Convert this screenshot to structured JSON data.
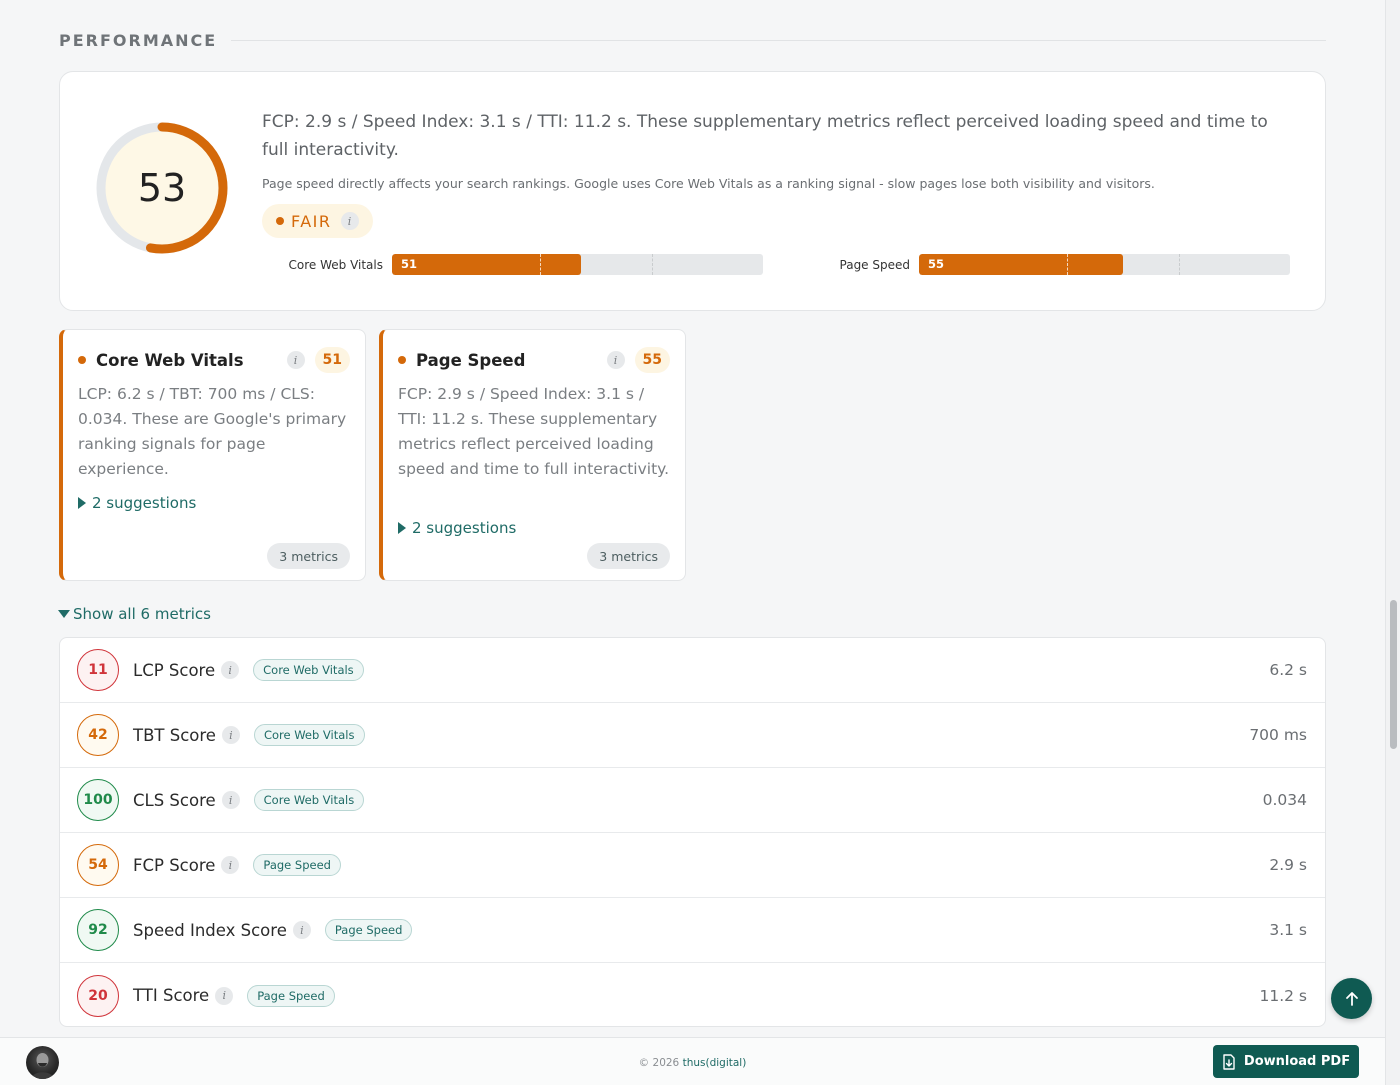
{
  "section": {
    "title": "PERFORMANCE"
  },
  "summary": {
    "score": "53",
    "score_fraction": 0.53,
    "text": "FCP: 2.9 s / Speed Index: 3.1 s / TTI: 11.2 s. These supplementary metrics reflect perceived loading speed and time to full interactivity.",
    "note": "Page speed directly affects your search rankings. Google uses Core Web Vitals as a ranking signal - slow pages lose both visibility and visitors.",
    "rating": "FAIR",
    "bars": [
      {
        "label": "Core Web Vitals",
        "value": "51",
        "fraction": 0.51
      },
      {
        "label": "Page Speed",
        "value": "55",
        "fraction": 0.55
      }
    ]
  },
  "categories": [
    {
      "name": "Core Web Vitals",
      "score": "51",
      "description": "LCP: 6.2 s / TBT: 700 ms / CLS: 0.034. These are Google's primary ranking signals for page experience.",
      "suggestions": "2 suggestions",
      "metrics": "3 metrics"
    },
    {
      "name": "Page Speed",
      "score": "55",
      "description": "FCP: 2.9 s / Speed Index: 3.1 s / TTI: 11.2 s. These supplementary metrics reflect perceived loading speed and time to full interactivity.",
      "suggestions": "2 suggestions",
      "metrics": "3 metrics"
    }
  ],
  "show_all_label": "Show all 6 metrics",
  "metrics": [
    {
      "score": "11",
      "name": "LCP Score",
      "tag": "Core Web Vitals",
      "value": "6.2 s",
      "status": "poor"
    },
    {
      "score": "42",
      "name": "TBT Score",
      "tag": "Core Web Vitals",
      "value": "700 ms",
      "status": "fair"
    },
    {
      "score": "100",
      "name": "CLS Score",
      "tag": "Core Web Vitals",
      "value": "0.034",
      "status": "good"
    },
    {
      "score": "54",
      "name": "FCP Score",
      "tag": "Page Speed",
      "value": "2.9 s",
      "status": "fair"
    },
    {
      "score": "92",
      "name": "Speed Index Score",
      "tag": "Page Speed",
      "value": "3.1 s",
      "status": "good"
    },
    {
      "score": "20",
      "name": "TTI Score",
      "tag": "Page Speed",
      "value": "11.2 s",
      "status": "poor"
    }
  ],
  "footer": {
    "copyright_prefix": "© 2026",
    "brand": "thus(digital)",
    "download_label": "Download PDF"
  },
  "colors": {
    "accent": "#d4690a",
    "brand": "#0f5a52",
    "good": "#1f8a4a",
    "fair": "#d4690a",
    "poor": "#d0343a"
  }
}
